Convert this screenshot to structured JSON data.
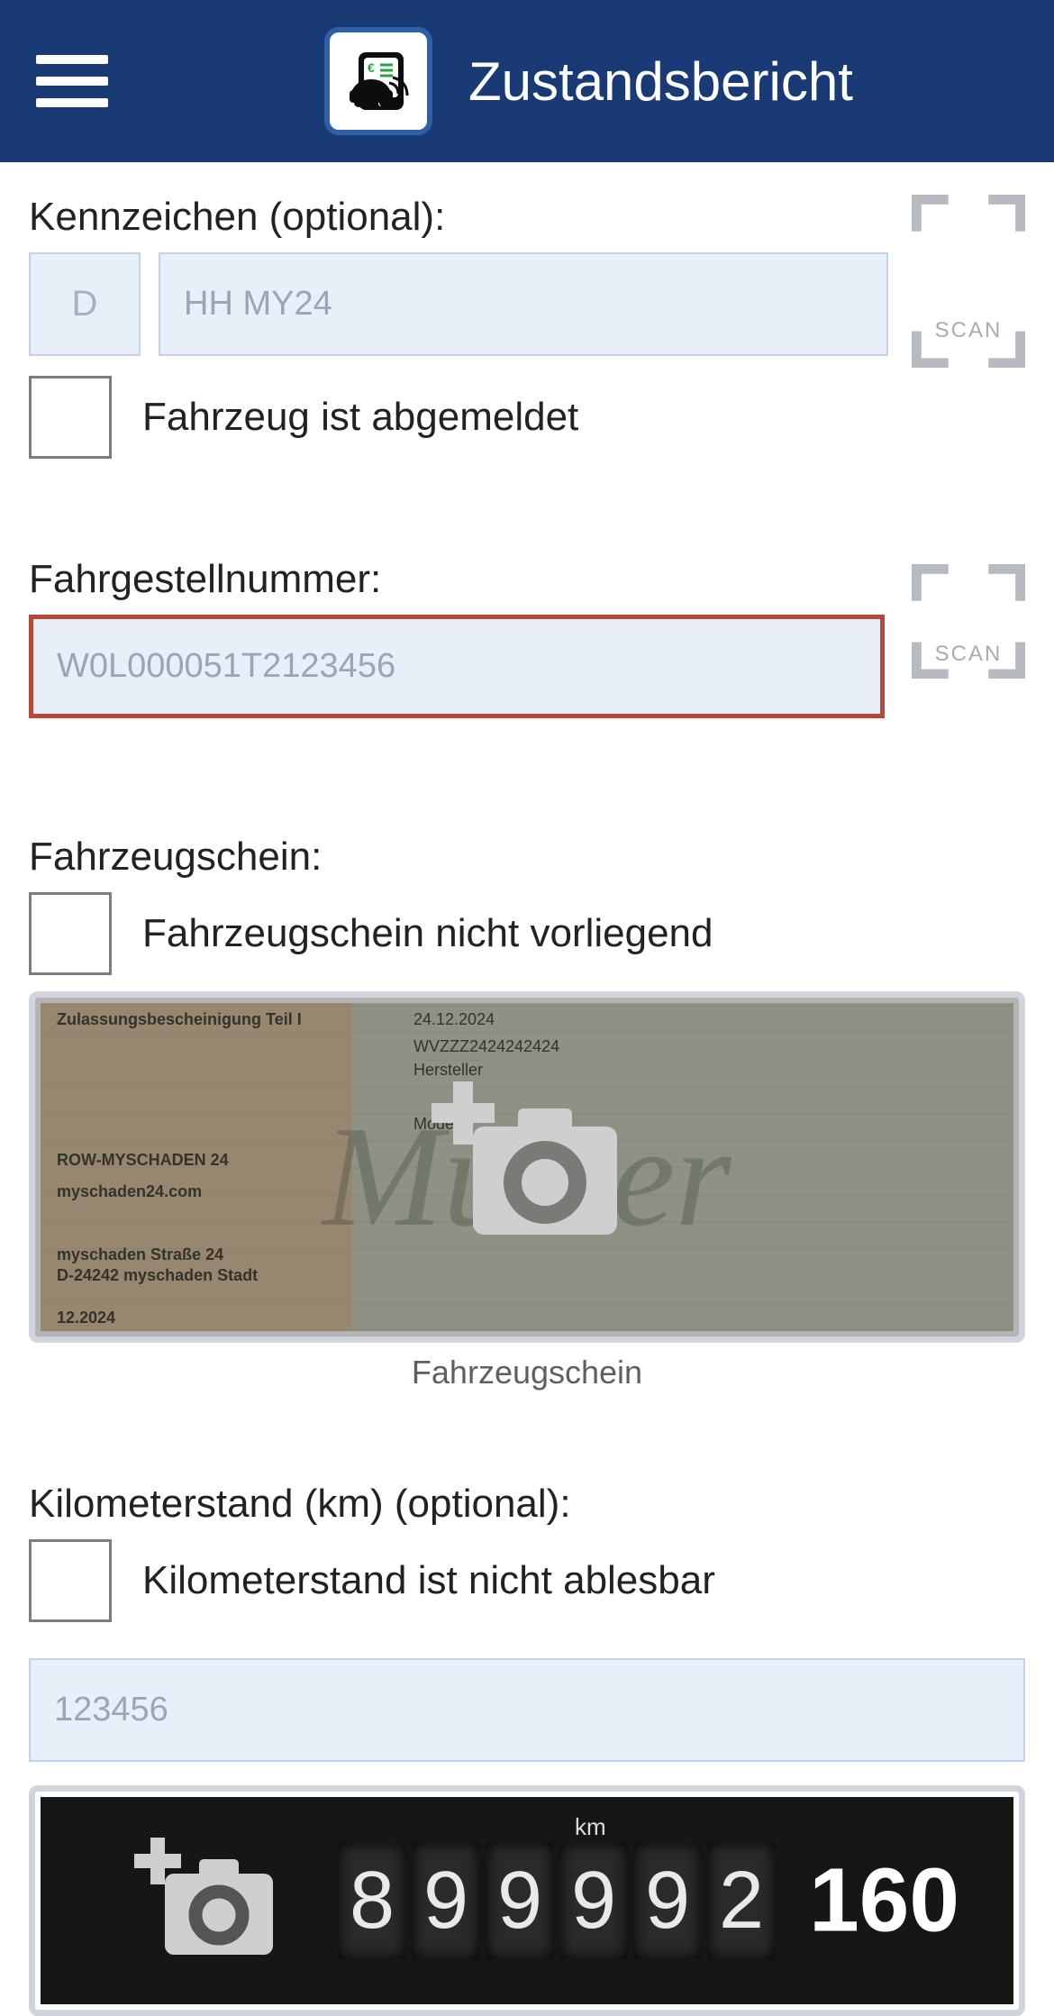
{
  "header": {
    "title": "Zustandsbericht"
  },
  "scan_label": "SCAN",
  "kennzeichen": {
    "label": "Kennzeichen (optional):",
    "country": "D",
    "placeholder": "HH MY24",
    "checkbox_label": "Fahrzeug ist abgemeldet"
  },
  "fahrgestellnummer": {
    "label": "Fahrgestellnummer:",
    "placeholder": "W0L000051T2123456"
  },
  "fahrzeugschein": {
    "label": "Fahrzeugschein:",
    "checkbox_label": "Fahrzeugschein nicht vorliegend",
    "caption": "Fahrzeugschein",
    "doc_sample": {
      "title": "Zulassungsbescheinigung Teil I",
      "watermark": "Muster",
      "date": "24.12.2024",
      "vin": "WVZZZ2424242424",
      "owner": "ROW-MYSCHADEN 24",
      "website": "myschaden24.com",
      "street": "myschaden Straße 24",
      "city": "D-24242 myschaden Stadt",
      "date2": "12.2024",
      "labels": {
        "hersteller": "Hersteller",
        "modell": "Modell"
      }
    }
  },
  "kilometer": {
    "label": "Kilometerstand (km) (optional):",
    "checkbox_label": "Kilometerstand ist nicht ablesbar",
    "placeholder": "123456",
    "odo_sample": {
      "km_label": "km",
      "digits": [
        "8",
        "9",
        "9",
        "9",
        "9",
        "2"
      ],
      "speed": "160"
    }
  }
}
